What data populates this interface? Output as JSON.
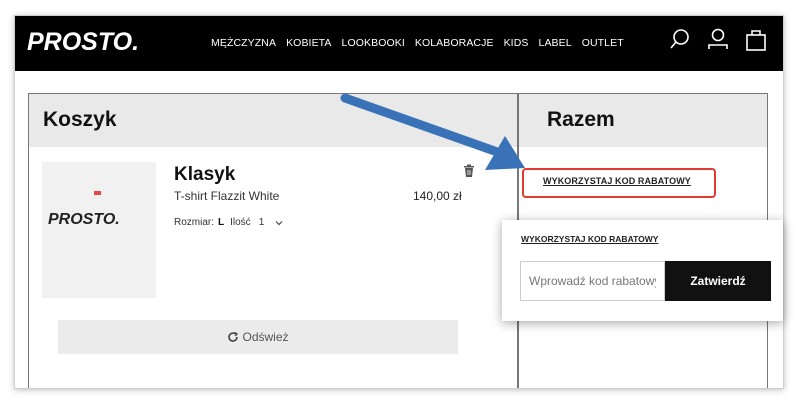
{
  "header": {
    "logo": "PROSTO.",
    "menu": [
      "MĘŻCZYZNA",
      "KOBIETA",
      "LOOKBOOKI",
      "KOLABORACJE",
      "KIDS",
      "LABEL",
      "OUTLET"
    ],
    "icons": [
      "search-icon",
      "account-icon",
      "cart-icon"
    ]
  },
  "cart": {
    "title": "Koszyk",
    "item": {
      "name": "Klasyk",
      "description": "T-shirt Flazzit White",
      "price": "140,00 zł",
      "size_label": "Rozmiar:",
      "size_value": "L",
      "qty_label": "Ilość",
      "qty_value": "1",
      "image_logo": "PROSTO."
    },
    "refresh_label": "Odśwież"
  },
  "summary": {
    "title": "Razem",
    "discount_link": "WYKORZYSTAJ KOD RABATOWY"
  },
  "popup": {
    "title": "WYKORZYSTAJ KOD RABATOWY",
    "input_placeholder": "Wprowadź kod rabatowy",
    "confirm_label": "Zatwierdź"
  },
  "colors": {
    "highlight": "#e23b2e",
    "arrow": "#3a72b8",
    "header_bg": "#000000"
  }
}
